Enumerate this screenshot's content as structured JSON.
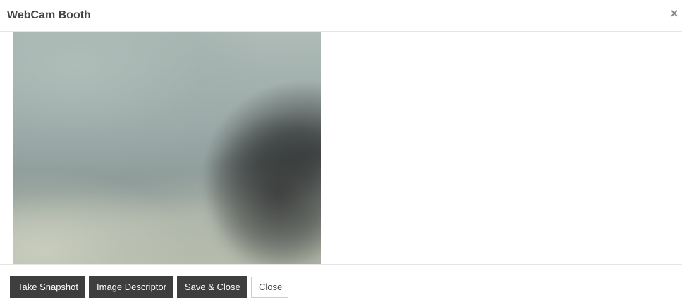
{
  "dialog": {
    "title": "WebCam Booth",
    "close_glyph": "×",
    "close_icon": "close-icon"
  },
  "webcam": {
    "feed": "live-camera-preview"
  },
  "footer": {
    "take_snapshot_label": "Take Snapshot",
    "image_descriptor_label": "Image Descriptor",
    "save_close_label": "Save & Close",
    "close_label": "Close"
  },
  "colors": {
    "dark_button": "#3e3e3e",
    "title_text": "#444444",
    "divider": "#e5e5e5"
  }
}
